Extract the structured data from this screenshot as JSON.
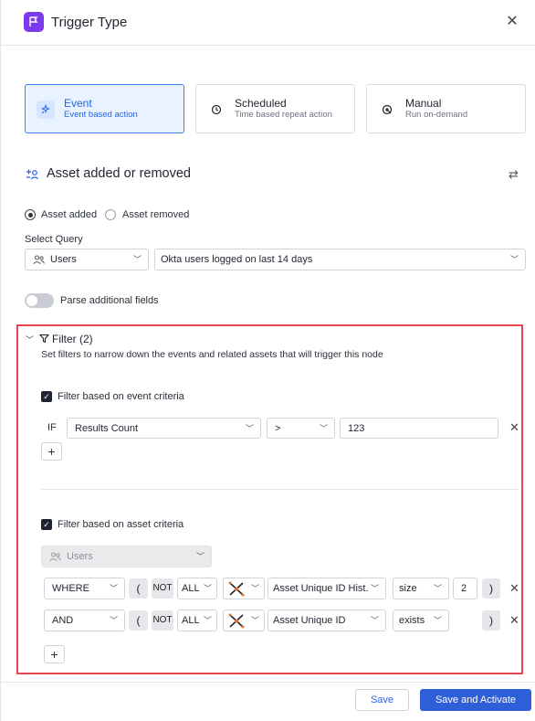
{
  "header": {
    "title": "Trigger Type",
    "icon": "flag-icon",
    "accent": "#7c3aed",
    "close_icon": "close-icon"
  },
  "trigger_types": [
    {
      "label": "Event",
      "desc": "Event based action",
      "icon": "event-icon",
      "selected": true
    },
    {
      "label": "Scheduled",
      "desc": "Time based repeat action",
      "icon": "clock-icon",
      "selected": false
    },
    {
      "label": "Manual",
      "desc": "Run on-demand",
      "icon": "manual-icon",
      "selected": false
    }
  ],
  "section": {
    "title": "Asset added or removed",
    "icon": "asset-change-icon",
    "action_icon": "swap-icon"
  },
  "event_radio": {
    "added_label": "Asset added",
    "removed_label": "Asset removed",
    "selected": "added"
  },
  "query": {
    "label": "Select Query",
    "entity": "Users",
    "entity_icon": "users-icon",
    "query": "Okta users logged on last 14 days"
  },
  "parse": {
    "label": "Parse additional fields",
    "enabled": false
  },
  "filter": {
    "title": "Filter (2)",
    "description": "Set filters to narrow down the events and related assets that will trigger this node",
    "event_criteria": {
      "label": "Filter based on event criteria",
      "checked": true,
      "row": {
        "if_label": "IF",
        "field": "Results Count",
        "operator": ">",
        "value": "123"
      }
    },
    "asset_criteria": {
      "label": "Filter based on asset criteria",
      "checked": true,
      "entity": "Users",
      "rows": [
        {
          "conjunction": "WHERE",
          "open_paren": "(",
          "not_label": "NOT",
          "quantifier": "ALL",
          "field": "Asset Unique ID Hist...",
          "operator": "size",
          "value": "2",
          "close_paren": ")"
        },
        {
          "conjunction": "AND",
          "open_paren": "(",
          "not_label": "NOT",
          "quantifier": "ALL",
          "field": "Asset Unique ID",
          "operator": "exists",
          "value": "",
          "close_paren": ")"
        }
      ]
    },
    "highlight_color": "#e8464d"
  },
  "footer": {
    "save_label": "Save",
    "activate_label": "Save and Activate",
    "primary_color": "#2f5fd8"
  }
}
